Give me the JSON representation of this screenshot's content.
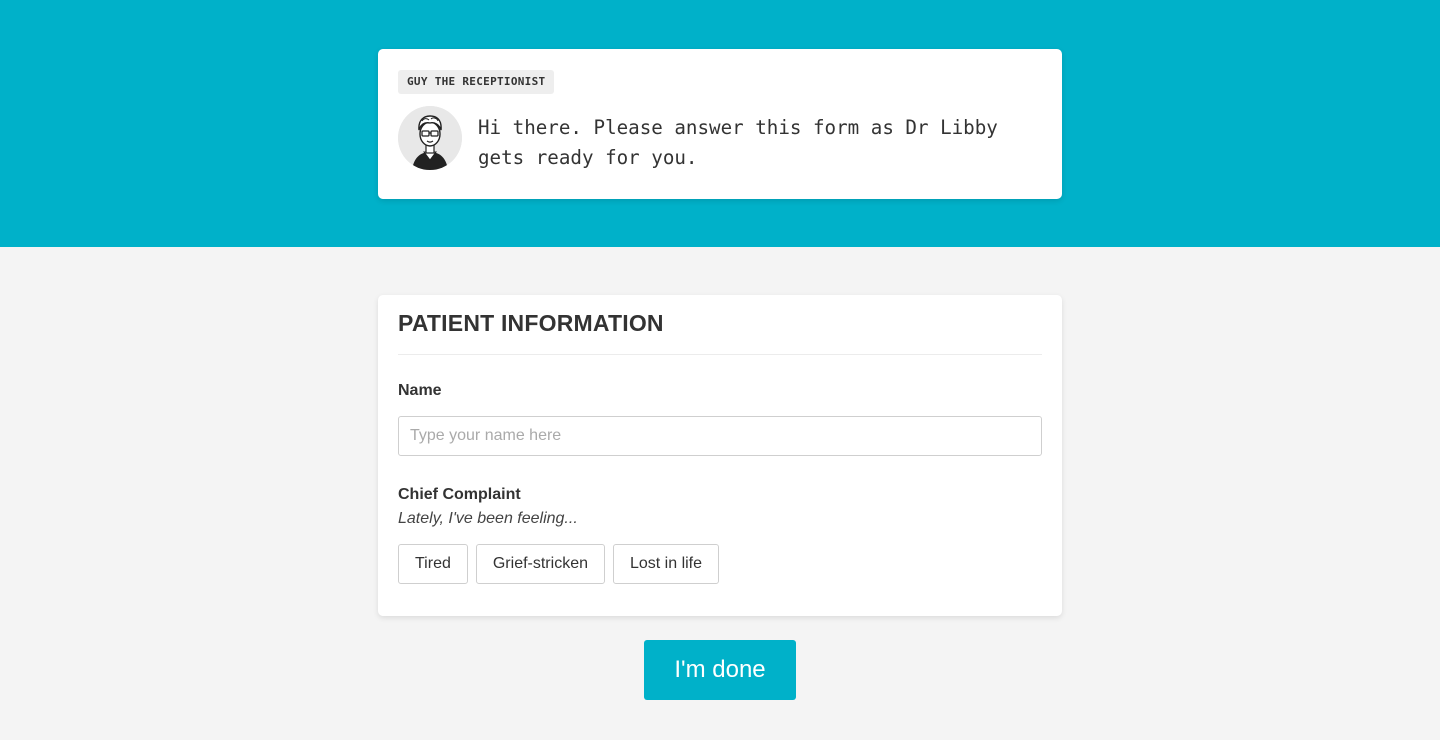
{
  "receptionist": {
    "tag": "GUY THE RECEPTIONIST",
    "message": "Hi there. Please answer this form as Dr Libby gets ready for you.",
    "avatar_icon": "person-with-glasses-icon"
  },
  "form": {
    "title": "PATIENT INFORMATION",
    "name_field": {
      "label": "Name",
      "placeholder": "Type your name here",
      "value": ""
    },
    "complaint": {
      "label": "Chief Complaint",
      "hint": "Lately, I've been feeling...",
      "options": [
        "Tired",
        "Grief-stricken",
        "Lost in life"
      ]
    }
  },
  "done_button": {
    "label": "I'm done"
  },
  "colors": {
    "accent": "#00b1c9",
    "background": "#f4f4f4",
    "card": "#ffffff",
    "text": "#333333"
  }
}
